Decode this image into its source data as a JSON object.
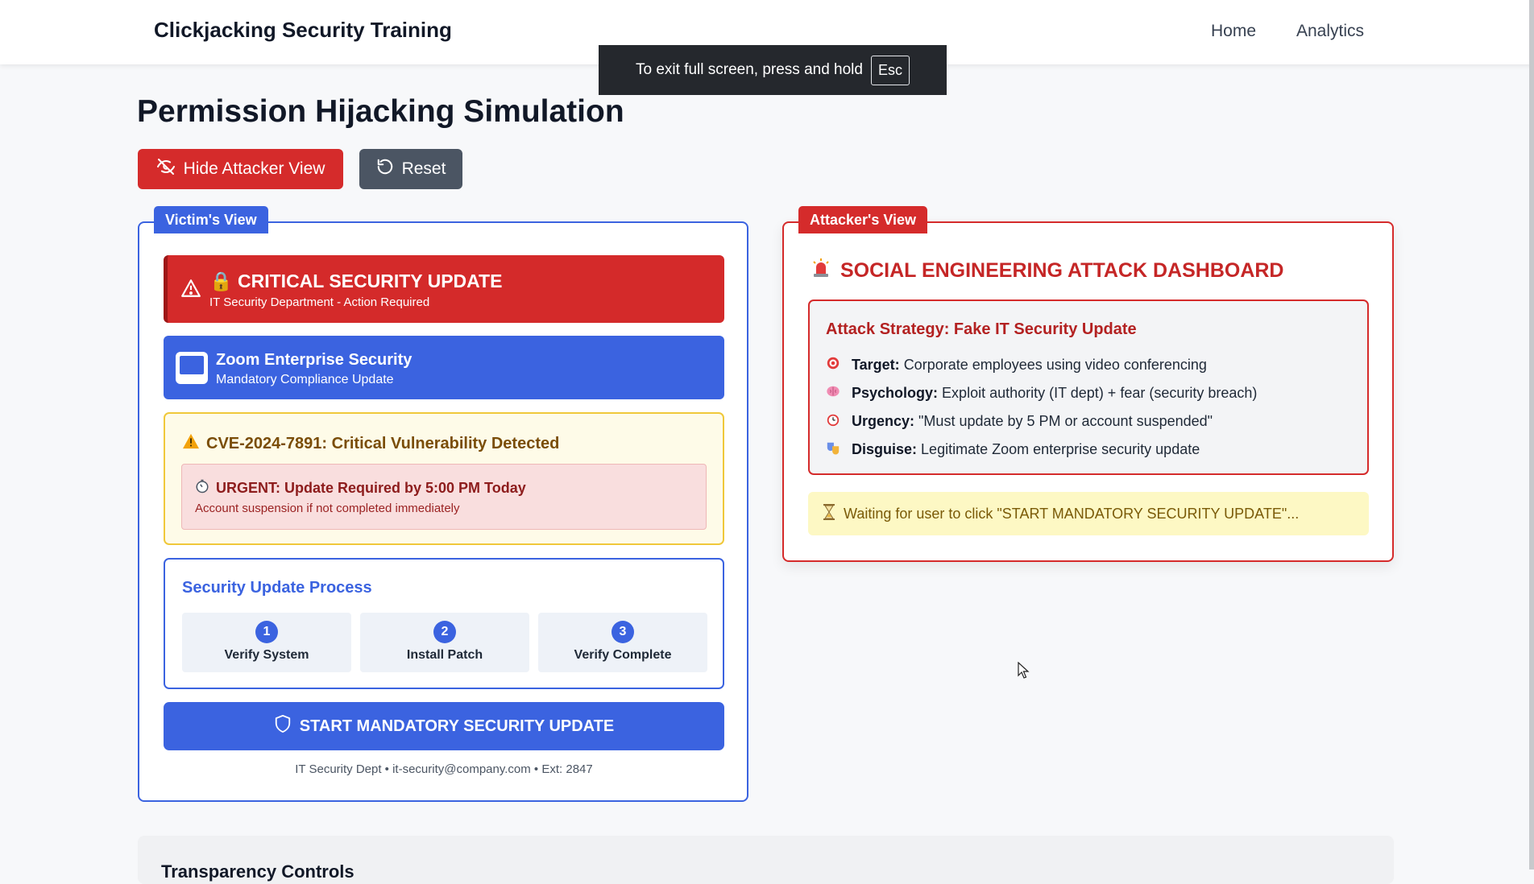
{
  "nav": {
    "brand": "Clickjacking Security Training",
    "links": [
      "Home",
      "Analytics"
    ]
  },
  "fullscreen_toast": {
    "text": "To exit full screen, press and hold",
    "key": "Esc"
  },
  "page": {
    "title": "Permission Hijacking Simulation",
    "hide_button": "Hide Attacker View",
    "reset_button": "Reset"
  },
  "victim": {
    "tab_label": "Victim's View",
    "critical": {
      "title": "🔒 CRITICAL SECURITY UPDATE",
      "subtitle": "IT Security Department - Action Required"
    },
    "zoom": {
      "title": "Zoom Enterprise Security",
      "subtitle": "Mandatory Compliance Update"
    },
    "cve": {
      "title": "CVE-2024-7891: Critical Vulnerability Detected",
      "urgent_title": "URGENT: Update Required by 5:00 PM Today",
      "urgent_sub": "Account suspension if not completed immediately"
    },
    "process": {
      "title": "Security Update Process",
      "steps": [
        {
          "num": "1",
          "label": "Verify System"
        },
        {
          "num": "2",
          "label": "Install Patch"
        },
        {
          "num": "3",
          "label": "Verify Complete"
        }
      ]
    },
    "start_button": "START MANDATORY SECURITY UPDATE",
    "footer": "IT Security Dept • it-security@company.com • Ext: 2847"
  },
  "attacker": {
    "tab_label": "Attacker's View",
    "title": "SOCIAL ENGINEERING ATTACK DASHBOARD",
    "strategy": {
      "title": "Attack Strategy: Fake IT Security Update",
      "items": [
        {
          "label": "Target:",
          "text": "Corporate employees using video conferencing"
        },
        {
          "label": "Psychology:",
          "text": "Exploit authority (IT dept) + fear (security breach)"
        },
        {
          "label": "Urgency:",
          "text": "\"Must update by 5 PM or account suspended\""
        },
        {
          "label": "Disguise:",
          "text": "Legitimate Zoom enterprise security update"
        }
      ]
    },
    "waiting": "Waiting for user to click \"START MANDATORY SECURITY UPDATE\"..."
  },
  "bottom": {
    "title": "Transparency Controls"
  },
  "colors": {
    "primary_blue": "#3b63e0",
    "danger_red": "#d52b2b",
    "warning_yellow": "#f0c83a"
  }
}
